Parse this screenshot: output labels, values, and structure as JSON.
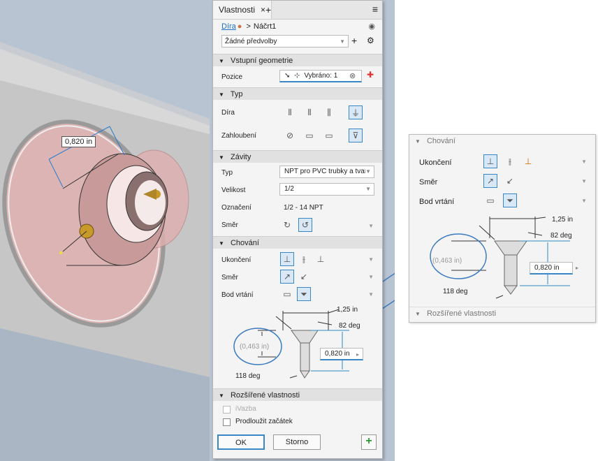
{
  "viewport": {
    "dimension_value": "0,820 in"
  },
  "panel": {
    "tab_title": "Vlastnosti",
    "tab_close": "×",
    "tab_add": "+",
    "menu_icon": "hamburger-icon",
    "breadcrumb": {
      "feature": "Díra",
      "sketch": "Náčrt1",
      "separator": ">"
    },
    "preset": {
      "value": "Žádné předvolby"
    },
    "sections": {
      "input_geometry": {
        "title": "Vstupní geometrie",
        "position_label": "Pozice",
        "position_value": "Vybráno: 1"
      },
      "type": {
        "title": "Typ",
        "hole_label": "Díra",
        "counterbore_label": "Zahloubení"
      },
      "threads": {
        "title": "Závity",
        "type_label": "Typ",
        "type_value": "NPT pro PVC trubky a tvar",
        "size_label": "Velikost",
        "size_value": "1/2",
        "designation_label": "Označení",
        "designation_value": "1/2 - 14 NPT",
        "direction_label": "Směr"
      },
      "behavior": {
        "title": "Chování",
        "termination_label": "Ukončení",
        "direction_label": "Směr",
        "drill_point_label": "Bod vrtání",
        "diagram": {
          "top_diameter": "1,25 in",
          "countersink_angle": "82 deg",
          "countersink_depth": "(0,463 in)",
          "depth_value": "0,820 in",
          "drill_angle": "118 deg"
        }
      },
      "advanced": {
        "title": "Rozšířené vlastnosti",
        "ivazba_label": "iVazba",
        "extend_start_label": "Prodloužit začátek"
      }
    },
    "buttons": {
      "ok": "OK",
      "cancel": "Storno",
      "apply_icon": "plus-icon"
    }
  },
  "zoom": {
    "section_title": "Chování",
    "termination_label": "Ukončení",
    "direction_label": "Směr",
    "drill_point_label": "Bod vrtání",
    "top_diameter": "1,25 in",
    "countersink_angle": "82 deg",
    "countersink_depth": "(0,463 in)",
    "depth_value": "0,820 in",
    "drill_angle": "118 deg",
    "advanced_title": "Rozšířené vlastnosti"
  },
  "colors": {
    "accent": "#3a87c8",
    "callout": "#3a7bbf",
    "hole_fill": "#e8b8b8"
  }
}
